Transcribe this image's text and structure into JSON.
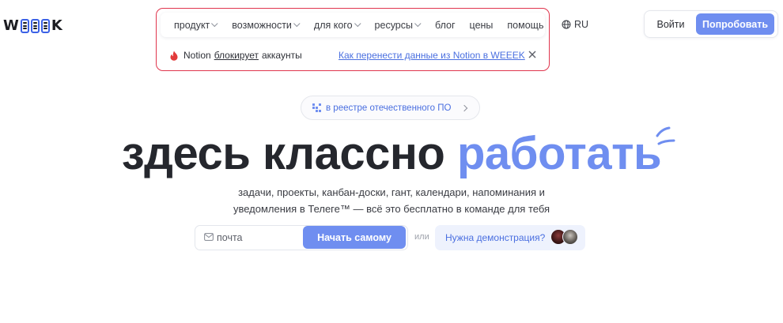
{
  "logo": {
    "left": "W",
    "right": "K"
  },
  "nav": {
    "items": [
      {
        "label": "продукт",
        "dropdown": true
      },
      {
        "label": "возможности",
        "dropdown": true
      },
      {
        "label": "для кого",
        "dropdown": true
      },
      {
        "label": "ресурсы",
        "dropdown": true
      },
      {
        "label": "блог",
        "dropdown": false
      },
      {
        "label": "цены",
        "dropdown": false
      },
      {
        "label": "помощь",
        "dropdown": false
      }
    ],
    "language": "RU"
  },
  "announcement": {
    "prefix": "Notion",
    "emphasis": "блокирует",
    "suffix": "аккаунты",
    "link": "Как перенести данные из Notion в WEEEK"
  },
  "auth": {
    "login": "Войти",
    "try": "Попробовать"
  },
  "registry_chip": "в реестре отечественного ПО",
  "hero": {
    "main": "здесь классно",
    "accent": "работать"
  },
  "subtitle": {
    "line1": "задачи, проекты, канбан-доски, гант, календари, напоминания и",
    "line2": "уведомления в Телеге™ — всё это бесплатно в команде для тебя"
  },
  "signup": {
    "email_placeholder": "почта",
    "start_button": "Начать самому",
    "or": "или",
    "demo_button": "Нужна демонстрация?"
  },
  "colors": {
    "accent": "#6f8ef0",
    "link": "#4a6fe0",
    "highlight": "#e0354d"
  }
}
